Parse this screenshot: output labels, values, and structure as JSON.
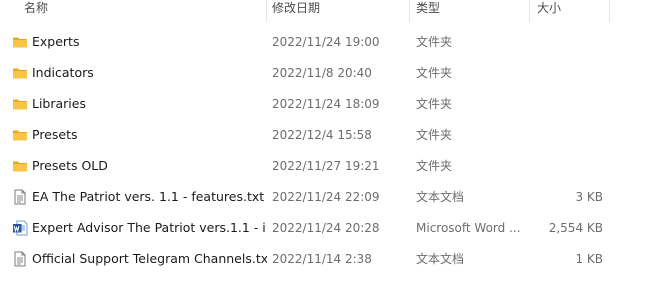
{
  "columns": {
    "name": "名称",
    "date": "修改日期",
    "type": "类型",
    "size": "大小"
  },
  "files": [
    {
      "name": "Experts",
      "date": "2022/11/24 19:00",
      "type": "文件夹",
      "size": "",
      "icon": "folder-icon"
    },
    {
      "name": "Indicators",
      "date": "2022/11/8 20:40",
      "type": "文件夹",
      "size": "",
      "icon": "folder-icon"
    },
    {
      "name": "Libraries",
      "date": "2022/11/24 18:09",
      "type": "文件夹",
      "size": "",
      "icon": "folder-icon"
    },
    {
      "name": "Presets",
      "date": "2022/12/4 15:58",
      "type": "文件夹",
      "size": "",
      "icon": "folder-icon"
    },
    {
      "name": "Presets OLD",
      "date": "2022/11/27 19:21",
      "type": "文件夹",
      "size": "",
      "icon": "folder-icon"
    },
    {
      "name": "EA The Patriot vers. 1.1 - features.txt",
      "date": "2022/11/24 22:09",
      "type": "文本文档",
      "size": "3 KB",
      "icon": "text-file-icon"
    },
    {
      "name": "Expert Advisor The Patriot vers.1.1 - i...",
      "date": "2022/11/24 20:28",
      "type": "Microsoft Word ...",
      "size": "2,554 KB",
      "icon": "word-document-icon"
    },
    {
      "name": "Official Support Telegram Channels.txt",
      "date": "2022/11/14 2:38",
      "type": "文本文档",
      "size": "1 KB",
      "icon": "text-file-icon"
    }
  ],
  "colors": {
    "folder": "#F8C546",
    "folder_dark": "#E8A81F",
    "word_blue": "#2B579A"
  }
}
